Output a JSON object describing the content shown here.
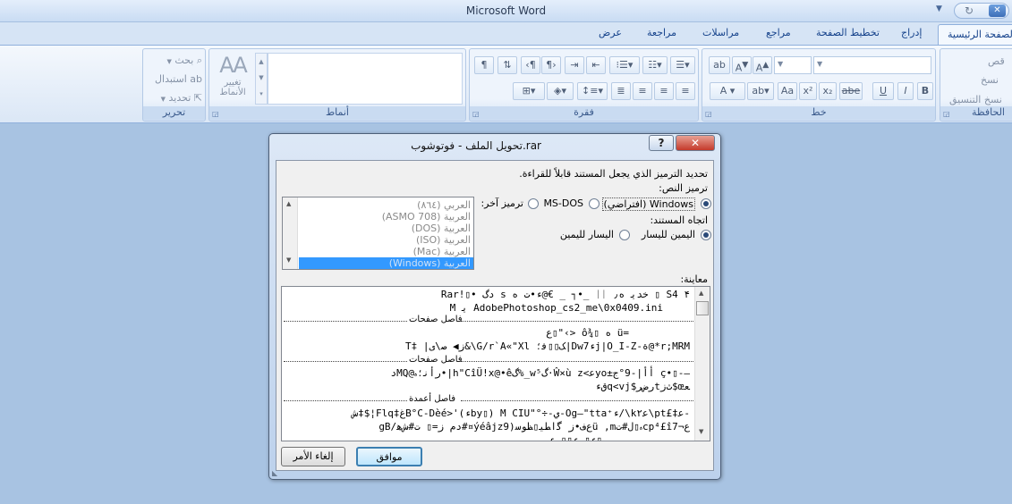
{
  "window": {
    "title": "Microsoft Word"
  },
  "tabs": [
    {
      "label": "الصفحة الرئيسية",
      "active": true
    },
    {
      "label": "إدراج"
    },
    {
      "label": "تخطيط الصفحة"
    },
    {
      "label": "مراجع"
    },
    {
      "label": "مراسلات"
    },
    {
      "label": "مراجعة"
    },
    {
      "label": "عرض"
    }
  ],
  "ribbon": {
    "clipboard": {
      "label": "الحافظة",
      "cut": "قص",
      "copy": "نسخ",
      "format_painter": "نسخ التنسيق"
    },
    "font": {
      "label": "خط"
    },
    "paragraph": {
      "label": "فقرة"
    },
    "styles": {
      "label": "أنماط",
      "change_styles_line1": "تغيير",
      "change_styles_line2": "الأنماط"
    },
    "editing": {
      "label": "تحرير",
      "find": "بحث",
      "replace": "استبدال",
      "select": "تحديد"
    }
  },
  "dialog": {
    "title": "تحويل الملف - فوتوشوب.rar",
    "instruction": "تحديد الترميز الذي يجعل المستند قابلاً للقراءة.",
    "text_encoding_label": "ترميز النص:",
    "encodings": {
      "windows": "Windows (افتراضي)",
      "msdos": "MS-DOS",
      "other": "ترميز آخر:"
    },
    "direction_label": "اتجاه المستند:",
    "directions": {
      "rtl": "اليمين لليسار",
      "ltr": "اليسار لليمين"
    },
    "encoding_list": [
      "العربي (٨٦٤)",
      "العربية (ASMO 708)",
      "العربية (DOS)",
      "العربية (ISO)",
      "العربية (Mac)",
      "العربية (Windows)"
    ],
    "selected_encoding": "العربية (Windows)",
    "preview_label": "معاينة:",
    "preview": {
      "line1": "Rar!▯•  دگ    s       ﺀ•ﺕ ﻩ@€ _ ┐•_  ᛁᛁ   ﺧﺪﯾ ﻩ٫  ▯ S4 ۴",
      "line2": "M ﻳ AdobePhotoshop_cs2_me\\0x0409.ini",
      "sep1": "فاصل صفحات",
      "line3": "ﻉ▯\"‹> ô¾▯ ﻩ ü=",
      "line4": "T‡ |ﺯ◀ ﺻ\\ﻯ&\\G/r`A«\"Xl ﮏ▯▯ﻓ؛|Dw7ﺀj|O_I-Z-ﺓ@*r;MRM",
      "sep2": "فاصل صفحات",
      "line5": "ﺩMQ@ﺭأﻧ؛ﮦ•|h\"CîÜ!x@•êﮒ%_w⁵ﮒ·Ŵ×ù z<ﻋyo±ﺃأ|-9°ﺝ ç•▯-—",
      "line6": "ﻕﺀq<vj$ﺭﺽﺮtﺙﺯ$œﻌ",
      "sep3": "فاصل أعمدة",
      "line7": "ﺵ‡$¦Flq‡ﻍB°C-Dèé>'(ﺀby▯) M CIU\"°÷-ﻱ-Og—\"tta⁺ﺀ/\\k۲ﻋ\\pt£‡ﻋ-",
      "line8": "gB/ﺩﻡ ﺯ=▯ ﺕ#ﺵﻫ#¤ýéâjzﻉﻑ•ﺯ ﮔﺍﻂﯿ▯ﻈﻮﺳ(9ü ,mﮦ▯ﻝ#ﺕcp⁴£î7¬ﻉ",
      "line9": "ﺀ▯   ﺀ▯▯  ﺀ▯"
    },
    "ok": "موافق",
    "cancel": "إلغاء الأمر"
  }
}
